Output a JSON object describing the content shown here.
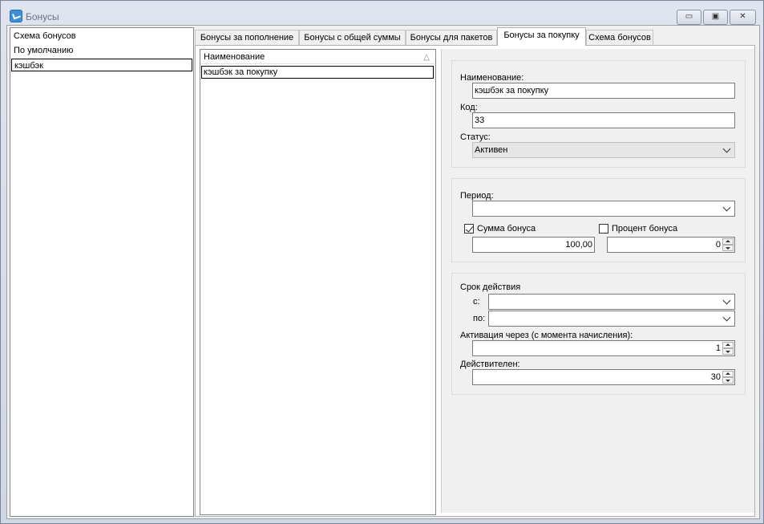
{
  "window": {
    "title": "Бонусы",
    "min_label": "▭",
    "max_label": "▣",
    "close_label": "✕"
  },
  "schemes": [
    {
      "label": "Схема бонусов"
    },
    {
      "label": "По умолчанию"
    },
    {
      "label": "кэшбэк"
    }
  ],
  "tabs": [
    {
      "label": "Бонусы за пополнение"
    },
    {
      "label": "Бонусы с общей суммы"
    },
    {
      "label": "Бонусы для пакетов"
    },
    {
      "label": "Бонусы за покупку"
    },
    {
      "label": "Схема бонусов"
    }
  ],
  "active_tab": "Бонусы за покупку",
  "grid": {
    "header": "Наименование",
    "sort_icon": "△",
    "rows": [
      {
        "name": "кэшбэк за покупку"
      }
    ]
  },
  "form": {
    "name_label": "Наименование:",
    "name_value": "кэшбэк за покупку",
    "code_label": "Код:",
    "code_value": "33",
    "status_label": "Статус:",
    "status_value": "Активен",
    "period_label": "Период:",
    "period_value": "",
    "bonus_sum_label": "Сумма бонуса",
    "bonus_sum_checked": true,
    "bonus_sum_value": "100,00",
    "bonus_percent_label": "Процент бонуса",
    "bonus_percent_checked": false,
    "bonus_percent_value": "0",
    "validity_label": "Срок действия",
    "from_label": "с:",
    "from_value": "",
    "to_label": "по:",
    "to_value": "",
    "activation_label": "Активация через (с момента начисления):",
    "activation_value": "1",
    "valid_label": "Действителен:",
    "valid_value": "30"
  },
  "icons": {
    "app": "bonus-app-icon",
    "dropdown": "chevron-down-icon",
    "spin": "spin-arrows-icon",
    "sort": "sort-triangle-icon"
  }
}
